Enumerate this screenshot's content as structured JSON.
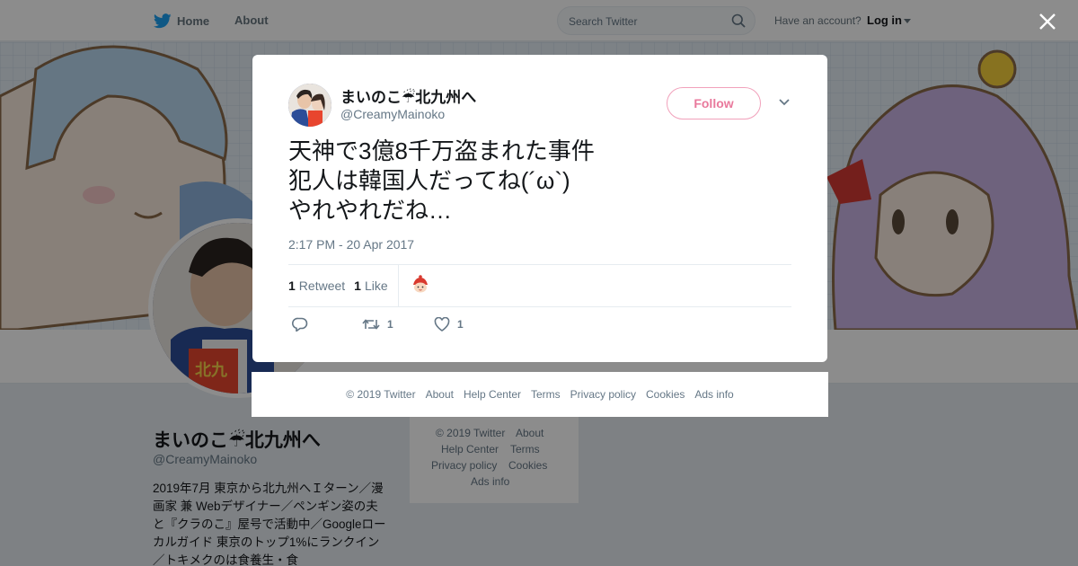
{
  "topbar": {
    "home_label": "Home",
    "about_label": "About",
    "search_placeholder": "Search Twitter",
    "have_account": "Have an account?",
    "login_label": "Log in"
  },
  "profile": {
    "name": "まいのこ☔北九州へ",
    "handle": "@CreamyMainoko",
    "bio": "2019年7月 東京から北九州へＩターン／漫画家 兼 Webデザイナー／ペンギン姿の夫と『クラのこ』屋号で活動中／Googleローカルガイド 東京のトップ1%にランクイン／トキメクのは食養生・食"
  },
  "side_footer": {
    "copyright": "© 2019 Twitter",
    "about": "About",
    "help": "Help Center",
    "terms": "Terms",
    "privacy": "Privacy policy",
    "cookies": "Cookies",
    "ads": "Ads info"
  },
  "tweet": {
    "display_name": "まいのこ☔北九州へ",
    "handle": "@CreamyMainoko",
    "follow_label": "Follow",
    "text": "天神で3億8千万盗まれた事件\n犯人は韓国人だってね(´ω`)\nやれやれだね…",
    "timestamp": "2:17 PM - 20 Apr 2017",
    "retweet_count": "1",
    "retweet_label": "Retweet",
    "like_count": "1",
    "like_label": "Like",
    "action_retweet_count": "1",
    "action_like_count": "1"
  },
  "modal_footer": {
    "copyright": "© 2019 Twitter",
    "about": "About",
    "help": "Help Center",
    "terms": "Terms",
    "privacy": "Privacy policy",
    "cookies": "Cookies",
    "ads": "Ads info"
  },
  "colors": {
    "brand": "#1da1f2",
    "follow_pink": "#e9799c",
    "muted": "#657786"
  }
}
